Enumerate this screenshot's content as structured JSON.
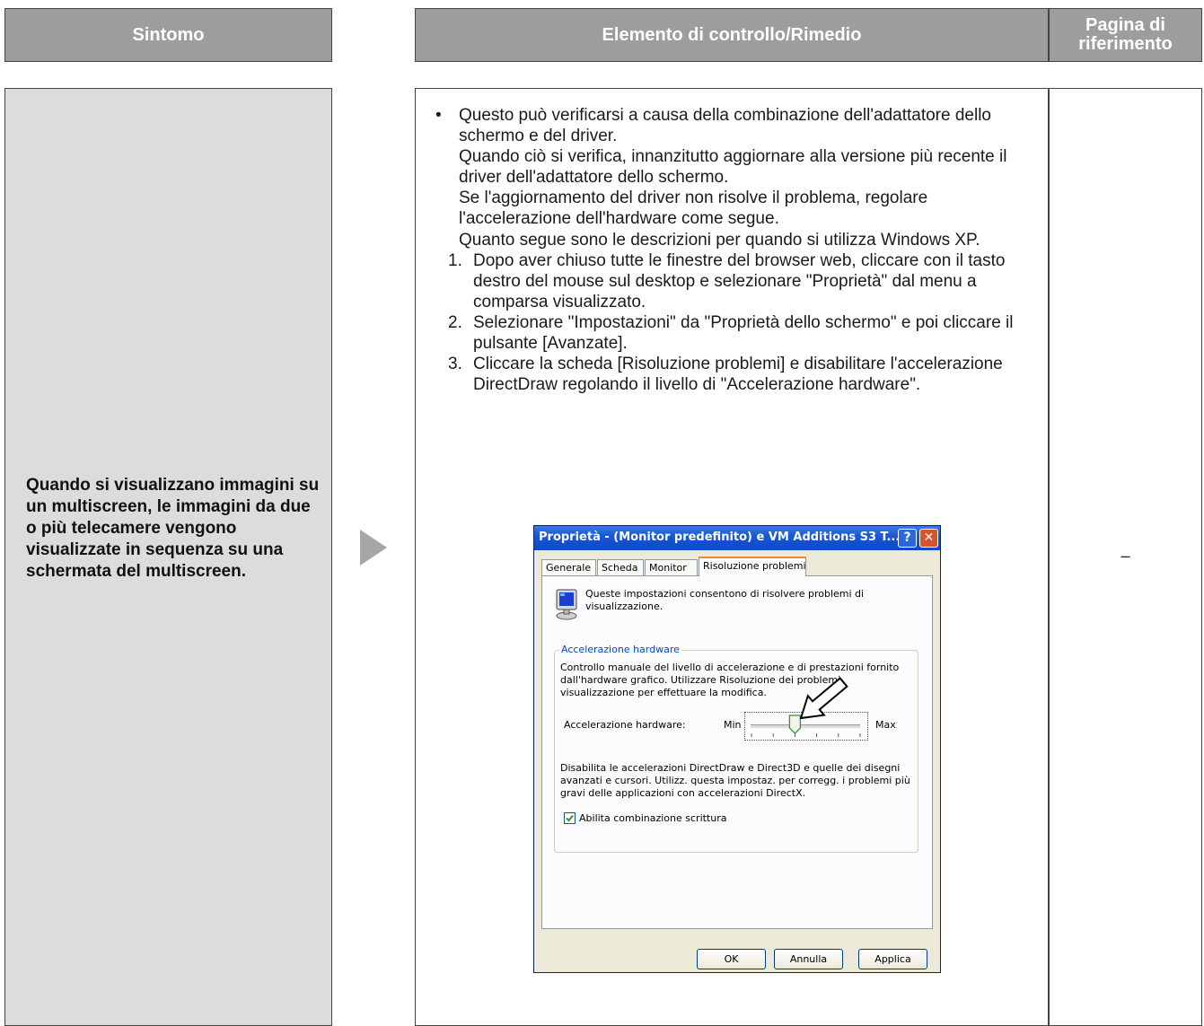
{
  "header": {
    "symptom": "Sintomo",
    "check": "Elemento di controllo/Rimedio",
    "ref_line1": "Pagina di",
    "ref_line2": "riferimento"
  },
  "symptom_text": "Quando si visualizzano immagini su un multiscreen, le immagini da due o più telecamere vengono visualizzate in sequenza su una schermata del multiscreen.",
  "remedy": {
    "bullet": "•",
    "paragraphs": [
      "Questo può verificarsi a causa della combinazione dell'adattatore dello schermo e del driver.",
      "Quando ciò si verifica, innanzitutto aggiornare alla versione più recente il driver dell'adattatore dello schermo.",
      "Se l'aggiornamento del driver non risolve il problema, regolare l'accelerazione dell'hardware come segue.",
      "Quanto segue sono le descrizioni per quando si utilizza Windows XP."
    ],
    "steps": [
      {
        "num": "1.",
        "text": "Dopo aver chiuso tutte le finestre del browser web, cliccare con il tasto destro del mouse sul desktop e selezionare \"Proprietà\" dal menu a comparsa visualizzato."
      },
      {
        "num": "2.",
        "text": "Selezionare \"Impostazioni\" da \"Proprietà dello schermo\" e poi cliccare il pulsante [Avanzate]."
      },
      {
        "num": "3.",
        "text": "Cliccare la scheda [Risoluzione problemi] e disabilitare l'accelerazione DirectDraw regolando il livello di \"Accelerazione hardware\"."
      }
    ]
  },
  "reference": "–",
  "dialog": {
    "title": "Proprietà - (Monitor predefinito) e VM Additions S3 T...",
    "help": "?",
    "close": "✕",
    "tabs": [
      "Generale",
      "Scheda",
      "Monitor",
      "Risoluzione problemi"
    ],
    "description": "Queste impostazioni consentono di risolvere problemi di visualizzazione.",
    "group_title": "Accelerazione hardware",
    "group_description": "Controllo manuale del livello di accelerazione e di prestazioni fornito dall'hardware grafico. Utilizzare Risoluzione dei problemi visualizzazione per effettuare la modifica.",
    "slider_label": "Accelerazione hardware:",
    "slider_min": "Min",
    "slider_max": "Max",
    "slider_level_fraction": 0.4,
    "tail_description": "Disabilita le accelerazioni DirectDraw e Direct3D e quelle dei disegni avanzati e cursori. Utilizz. questa impostaz. per corregg. i problemi più gravi delle applicazioni con accelerazioni DirectX.",
    "write_combining_label": "Abilita combinazione scrittura",
    "write_combining_checked": true,
    "buttons": {
      "ok": "OK",
      "cancel": "Annulla",
      "apply": "Applica"
    }
  }
}
